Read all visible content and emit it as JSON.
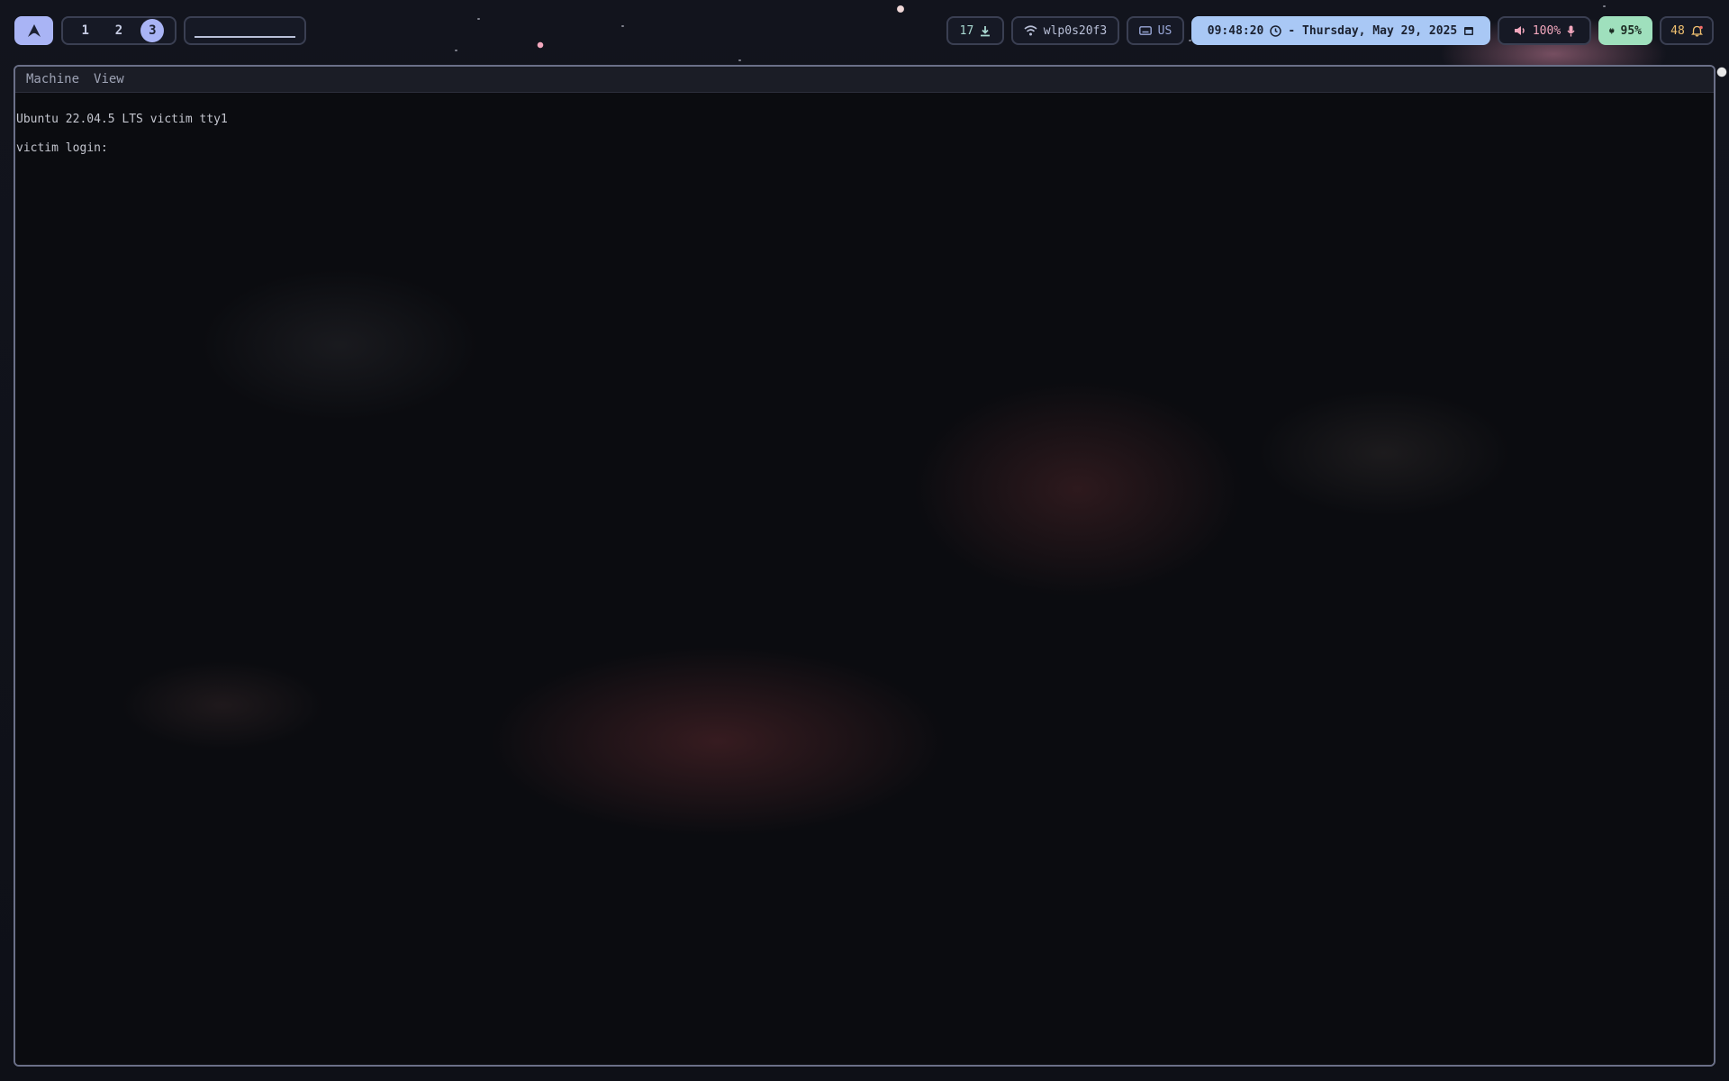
{
  "topbar": {
    "workspaces": [
      "1",
      "2",
      "3"
    ],
    "active_workspace": "3",
    "updates": "17",
    "network": "wlp0s20f3",
    "keyboard_layout": "US",
    "time": "09:48:20",
    "date": "- Thursday, May 29, 2025",
    "volume": "100%",
    "battery": "95%",
    "notifications": "48"
  },
  "vm_window": {
    "menu": [
      "Machine",
      "View"
    ],
    "console_lines": [
      "Ubuntu 22.04.5 LTS victim tty1",
      "victim login:"
    ]
  },
  "colors": {
    "accent": "#a9b4f5",
    "clock_bg": "#a9c8f5",
    "battery_bg": "#9fe0bd",
    "volume_text": "#f2a7bd",
    "bar_border": "#3a3f52"
  },
  "icons": [
    "arch-logo-icon",
    "download-icon",
    "wifi-icon",
    "keyboard-icon",
    "clock-icon",
    "calendar-icon",
    "speaker-icon",
    "microphone-icon",
    "plug-icon",
    "bell-icon"
  ]
}
